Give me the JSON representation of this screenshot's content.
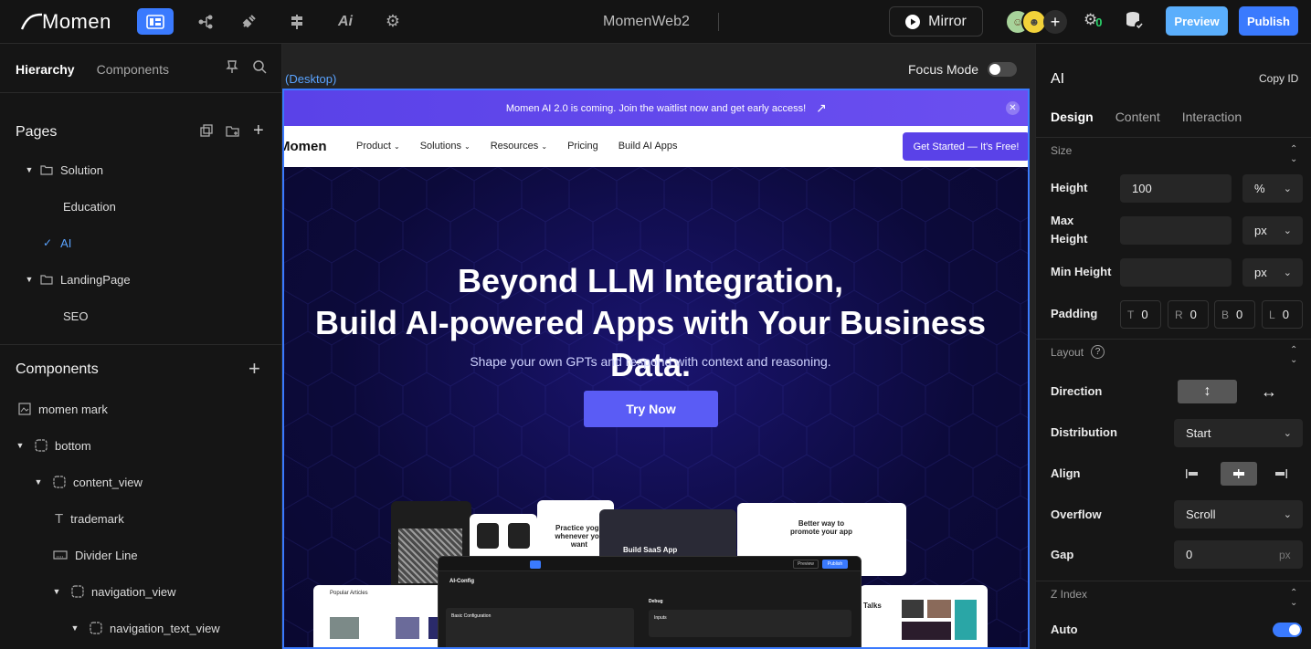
{
  "topbar": {
    "logo_text": "Momen",
    "app_title": "MomenWeb2",
    "mirror_label": "Mirror",
    "preview_label": "Preview",
    "publish_label": "Publish",
    "badge_count": "0",
    "accent_color": "#3a7afe"
  },
  "left": {
    "tabs": [
      "Hierarchy",
      "Components"
    ],
    "pages_title": "Pages",
    "pages": [
      {
        "label": "Solution"
      },
      {
        "label": "Education"
      },
      {
        "label": "AI"
      },
      {
        "label": "LandingPage"
      },
      {
        "label": "SEO"
      }
    ],
    "components_title": "Components",
    "components": [
      {
        "label": "momen mark"
      },
      {
        "label": "bottom"
      },
      {
        "label": "content_view"
      },
      {
        "label": "trademark"
      },
      {
        "label": "Divider Line"
      },
      {
        "label": "navigation_view"
      },
      {
        "label": "navigation_text_view"
      }
    ]
  },
  "canvas": {
    "device_label": "(Desktop)",
    "focus_mode_label": "Focus Mode",
    "banner_text": "Momen AI 2.0 is coming. Join the waitlist now and get early access!",
    "site_logo": "Momen",
    "nav": [
      "Product",
      "Solutions",
      "Resources",
      "Pricing",
      "Build AI Apps"
    ],
    "cta": "Get Started — It's Free!",
    "hero_line1": "Beyond LLM Integration,",
    "hero_line2": "Build AI-powered Apps with Your Business Data.",
    "hero_sub": "Shape your own GPTs and respond with context and reasoning.",
    "try_now": "Try Now",
    "mock_texts": {
      "yoga": "Practice yoga whenever you want",
      "saas": "Build SaaS App",
      "promote": "Better way to promote your app",
      "articles": "Popular Articles",
      "talks": "Talks",
      "ai_config": "AI-Config",
      "basic_config": "Basic Configuration",
      "debug": "Debug",
      "inputs": "Inputs",
      "preview": "Preview",
      "publish": "Publish"
    }
  },
  "right": {
    "title": "AI",
    "copy_id": "Copy ID",
    "tabs": [
      "Design",
      "Content",
      "Interaction"
    ],
    "size_section": "Size",
    "height_label": "Height",
    "height_value": "100",
    "height_unit": "%",
    "max_height_label_1": "Max",
    "max_height_label_2": "Height",
    "max_height_unit": "px",
    "min_height_label": "Min Height",
    "min_height_unit": "px",
    "padding_label": "Padding",
    "padding": [
      {
        "k": "T",
        "v": "0"
      },
      {
        "k": "R",
        "v": "0"
      },
      {
        "k": "B",
        "v": "0"
      },
      {
        "k": "L",
        "v": "0"
      }
    ],
    "layout_section": "Layout",
    "direction_label": "Direction",
    "distribution_label": "Distribution",
    "distribution_value": "Start",
    "align_label": "Align",
    "overflow_label": "Overflow",
    "overflow_value": "Scroll",
    "gap_label": "Gap",
    "gap_value": "0",
    "gap_unit": "px",
    "zindex_section": "Z Index",
    "auto_label": "Auto"
  }
}
